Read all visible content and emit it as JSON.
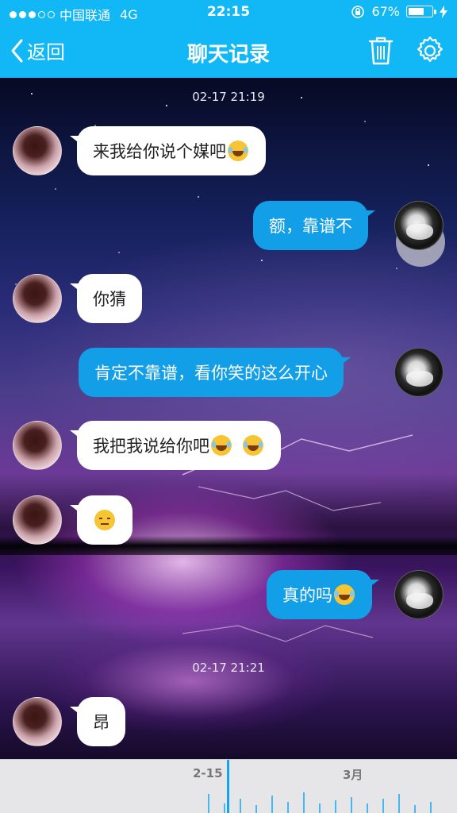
{
  "status": {
    "carrier": "中国联通",
    "network": "4G",
    "time": "22:15",
    "battery": "67%",
    "battery_level": 0.67
  },
  "nav": {
    "back_label": "返回",
    "title": "聊天记录"
  },
  "chat": {
    "timestamps": [
      "02-17 21:19",
      "02-17 21:21"
    ],
    "messages": [
      {
        "from": "friend",
        "text": "来我给你说个媒吧",
        "emoji": [
          "laugh"
        ]
      },
      {
        "from": "me",
        "text": "额，靠谱不",
        "emoji": []
      },
      {
        "from": "friend",
        "text": "你猜",
        "emoji": []
      },
      {
        "from": "me",
        "text": "肯定不靠谱，看你笑的这么开心",
        "emoji": []
      },
      {
        "from": "friend",
        "text": "我把我说给你吧",
        "emoji": [
          "laugh",
          "laugh"
        ]
      },
      {
        "from": "friend",
        "text": "",
        "emoji": [
          "sad"
        ]
      },
      {
        "from": "me",
        "text": "真的吗",
        "emoji": [
          "laugh"
        ]
      },
      {
        "from": "friend",
        "text": "昂",
        "emoji": []
      }
    ]
  },
  "timeline": {
    "labels": [
      "2-15",
      "3月"
    ]
  },
  "colors": {
    "accent": "#12b7f5",
    "outgoing_bubble": "#139fe8",
    "incoming_bubble": "#ffffff"
  }
}
